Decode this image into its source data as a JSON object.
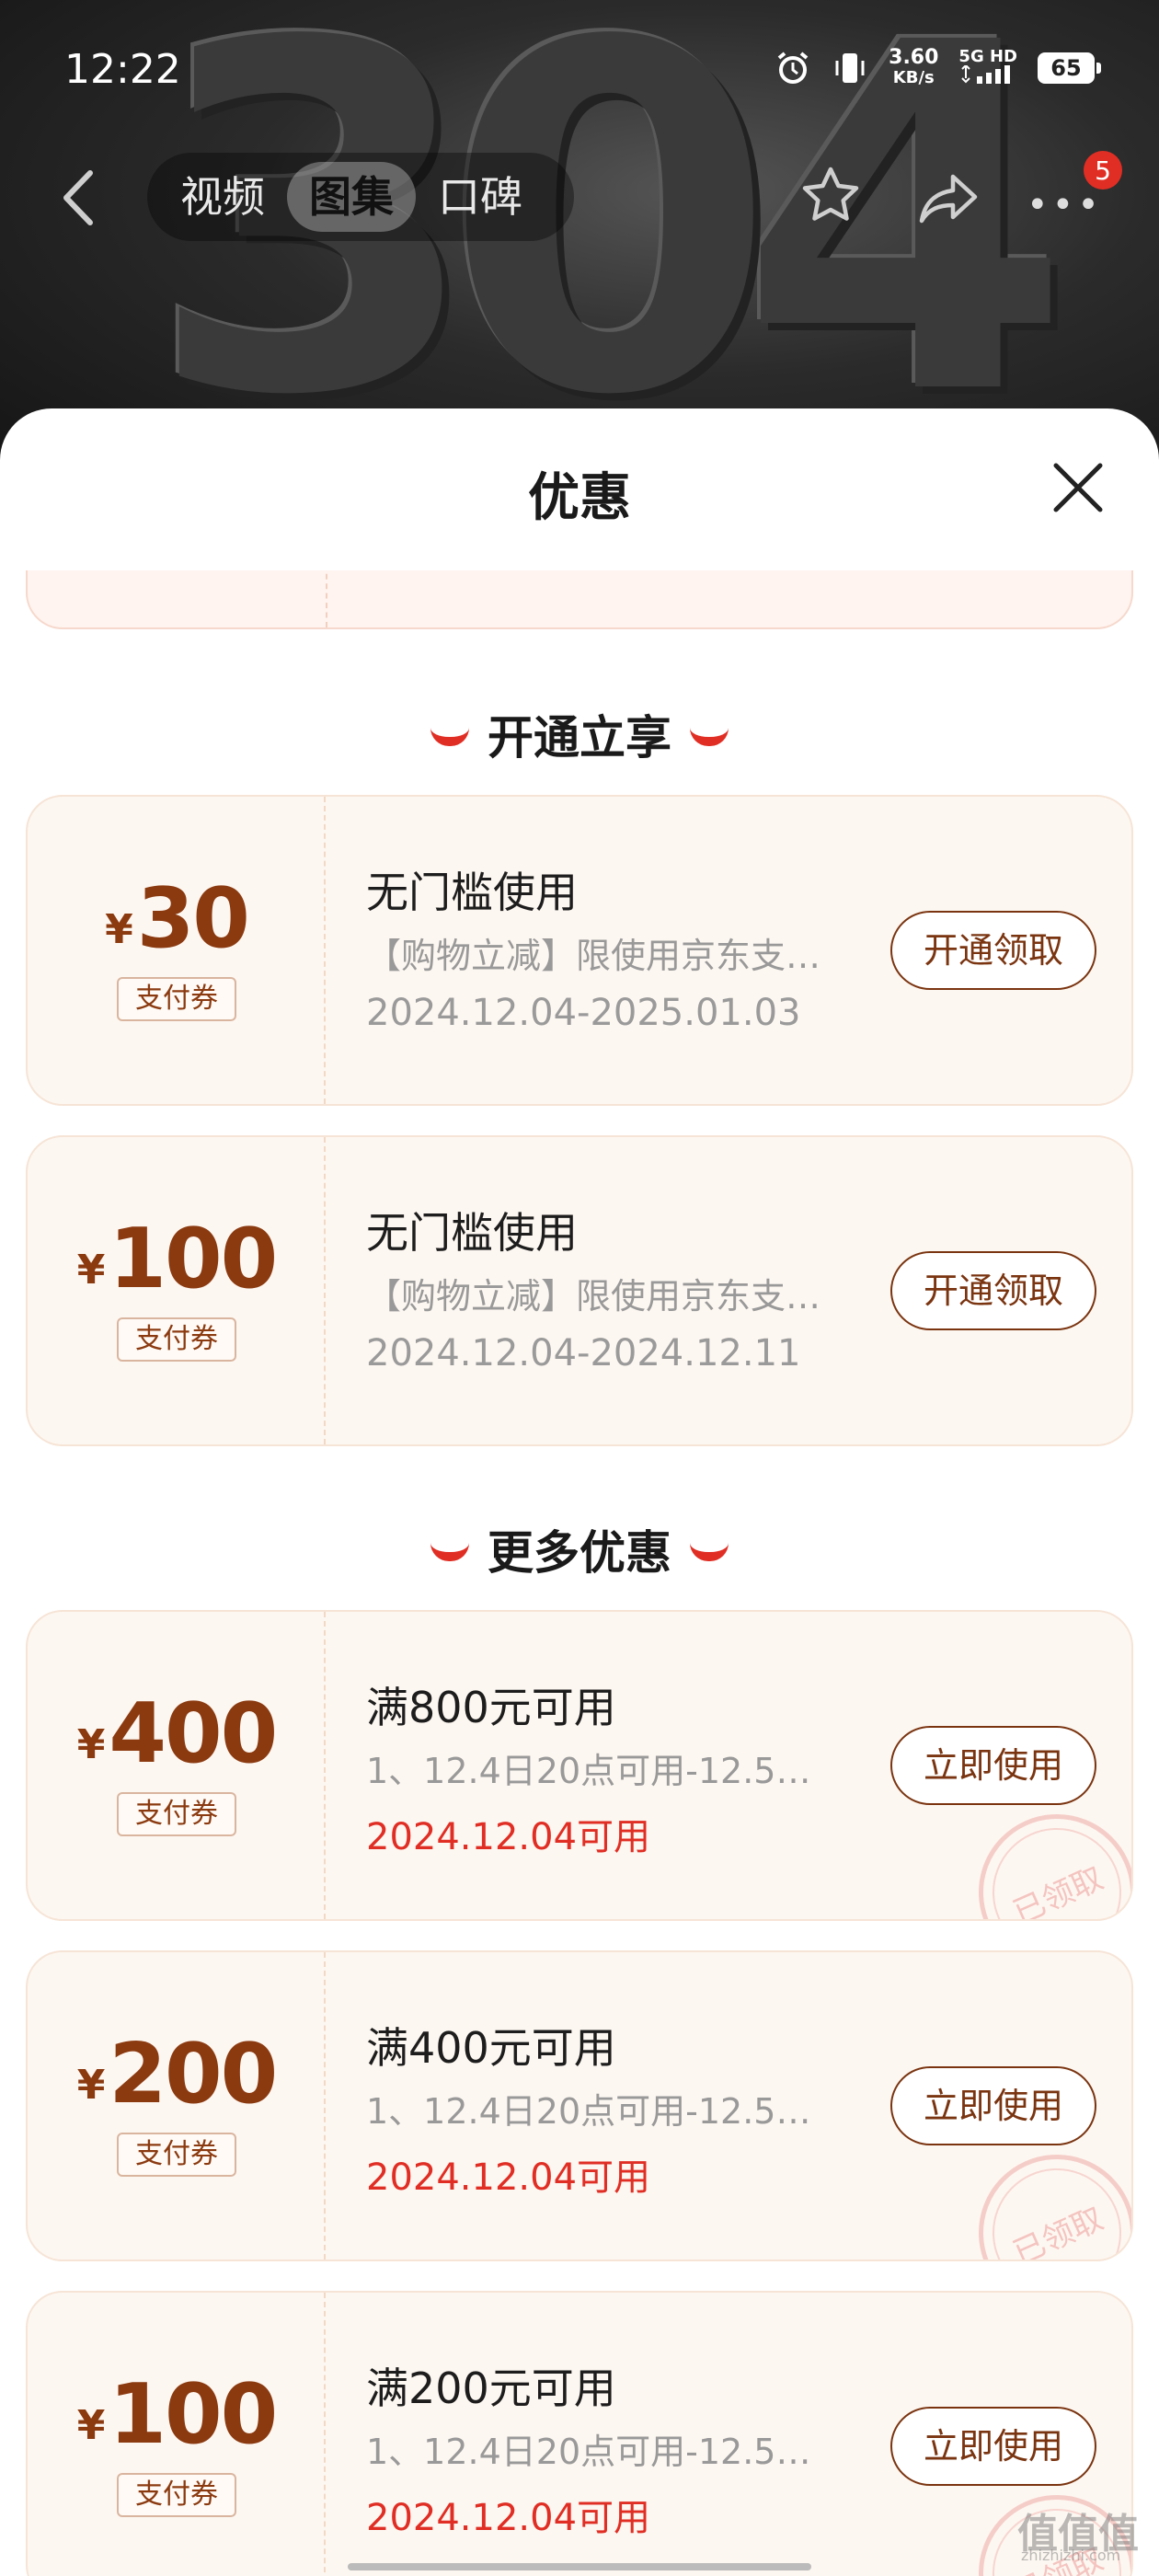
{
  "status_bar": {
    "time": "12:22",
    "speed_value": "3.60",
    "speed_unit": "KB/s",
    "network": "5G HD",
    "battery": "65"
  },
  "nav": {
    "tabs": [
      {
        "label": "视频",
        "active": false
      },
      {
        "label": "图集",
        "active": true
      },
      {
        "label": "口碑",
        "active": false
      }
    ],
    "more_badge": "5"
  },
  "sheet": {
    "title": "优惠"
  },
  "sections": [
    {
      "heading": "开通立享",
      "coupons": [
        {
          "amount": "30",
          "currency": "¥",
          "type": "支付券",
          "title": "无门槛使用",
          "desc": "【购物立减】限使用京东支…",
          "date": "2024.12.04-2025.01.03",
          "date_red": false,
          "button": "开通领取",
          "claimed": false
        },
        {
          "amount": "100",
          "currency": "¥",
          "type": "支付券",
          "title": "无门槛使用",
          "desc": "【购物立减】限使用京东支…",
          "date": "2024.12.04-2024.12.11",
          "date_red": false,
          "button": "开通领取",
          "claimed": false
        }
      ]
    },
    {
      "heading": "更多优惠",
      "coupons": [
        {
          "amount": "400",
          "currency": "¥",
          "type": "支付券",
          "title": "满800元可用",
          "desc": "1、12.4日20点可用-12.5…",
          "date": "2024.12.04可用",
          "date_red": true,
          "button": "立即使用",
          "claimed": true,
          "stamp": "已领取"
        },
        {
          "amount": "200",
          "currency": "¥",
          "type": "支付券",
          "title": "满400元可用",
          "desc": "1、12.4日20点可用-12.5…",
          "date": "2024.12.04可用",
          "date_red": true,
          "button": "立即使用",
          "claimed": true,
          "stamp": "已领取"
        },
        {
          "amount": "100",
          "currency": "¥",
          "type": "支付券",
          "title": "满200元可用",
          "desc": "1、12.4日20点可用-12.5…",
          "date": "2024.12.04可用",
          "date_red": true,
          "button": "立即使用",
          "claimed": true,
          "stamp": "已领取"
        }
      ]
    }
  ],
  "watermark": {
    "text": "值值值",
    "sub": "zhizhizhi.com"
  },
  "colors": {
    "accent_red": "#e02e24",
    "coupon_brown": "#8b3a10",
    "coupon_bg": "#fdf7f1"
  }
}
